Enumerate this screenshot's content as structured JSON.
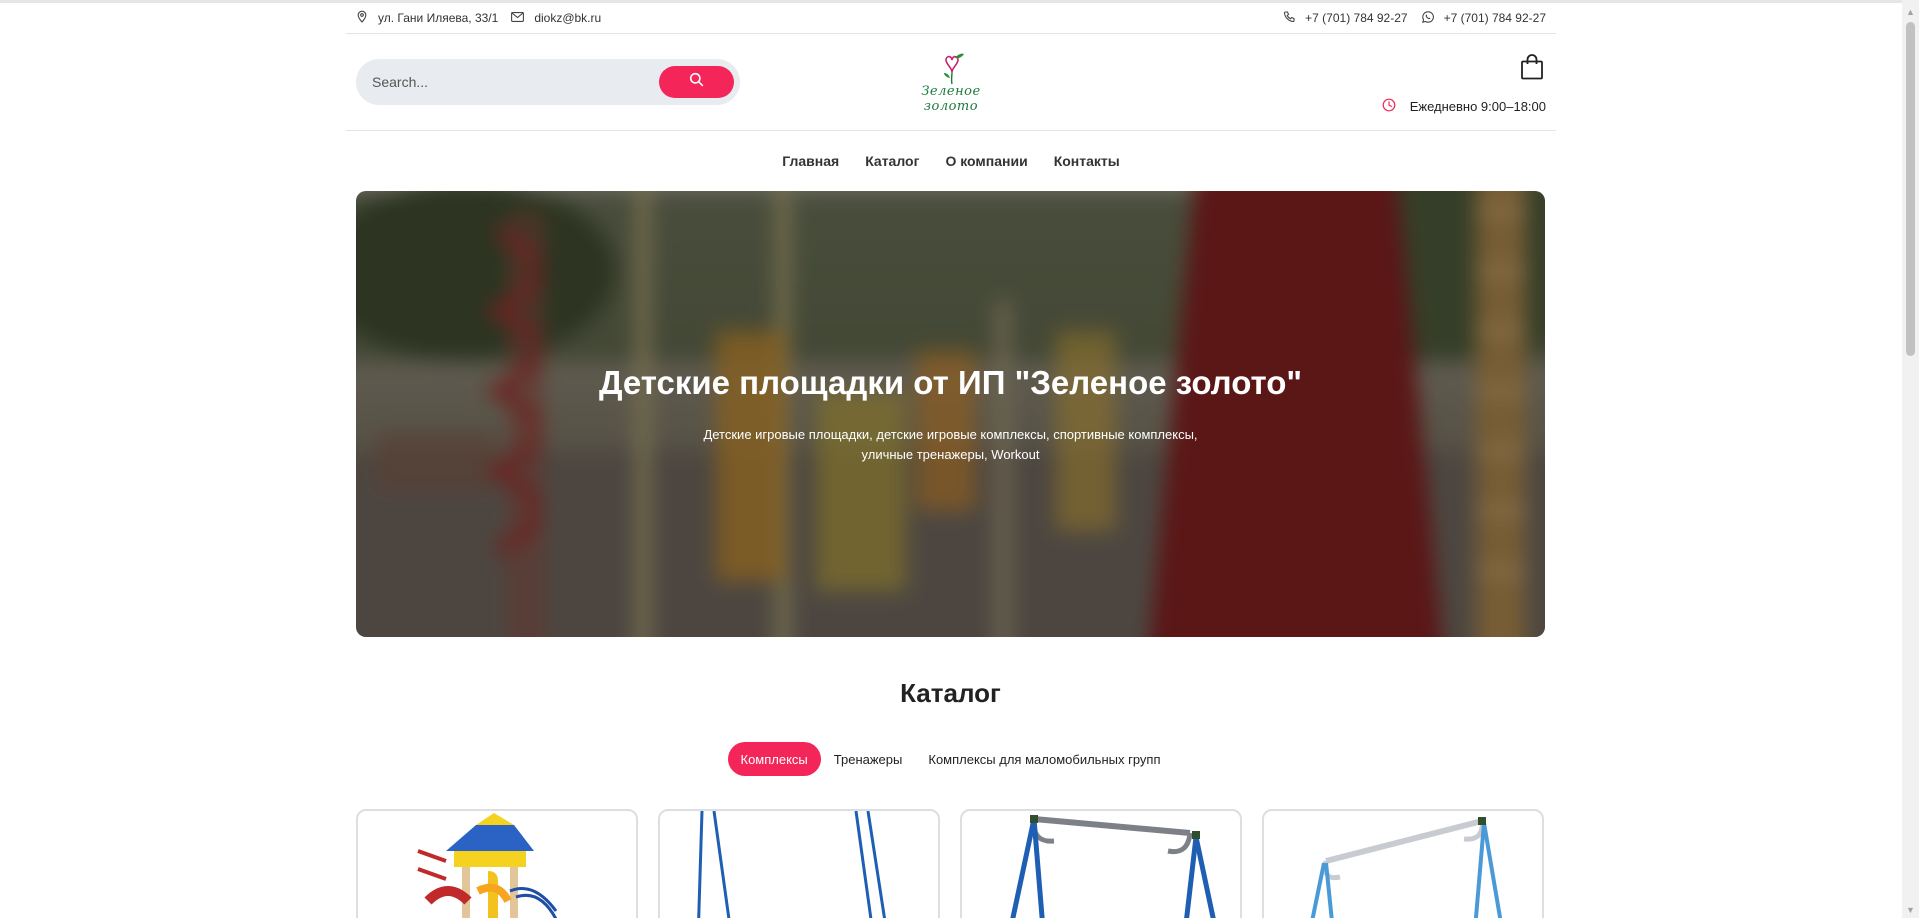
{
  "infobar": {
    "address": "ул. Гани Иляева, 33/1",
    "email": "diokz@bk.ru",
    "phone": "+7 (701) 784 92-27",
    "whatsapp": "+7 (701) 784 92-27"
  },
  "header": {
    "search_placeholder": "Search...",
    "logo_text": "Зеленое золото",
    "hours": "Ежедневно 9:00–18:00"
  },
  "nav": {
    "items": [
      {
        "label": "Главная"
      },
      {
        "label": "Каталог"
      },
      {
        "label": "О компании"
      },
      {
        "label": "Контакты"
      }
    ]
  },
  "hero": {
    "title": "Детские площадки от ИП \"Зеленое золото\"",
    "subtitle": "Детские игровые площадки, детские игровые комплексы, спортивные комплексы, уличные тренажеры, Workout"
  },
  "catalog": {
    "title": "Каталог",
    "tabs": [
      {
        "label": "Комплексы",
        "active": true
      },
      {
        "label": "Тренажеры",
        "active": false
      },
      {
        "label": "Комплексы для маломобильных групп",
        "active": false
      }
    ]
  },
  "colors": {
    "accent": "#f42659",
    "logo_green": "#1d7a3c",
    "search_bg": "#e8ebef"
  }
}
